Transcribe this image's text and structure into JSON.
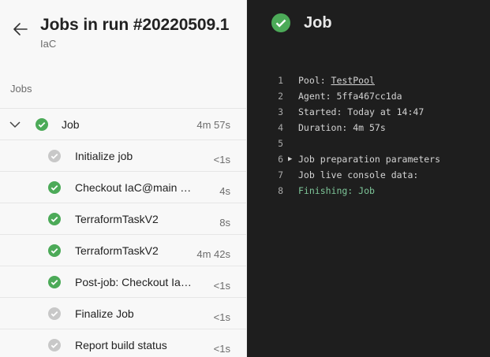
{
  "left": {
    "title": "Jobs in run #20220509.1",
    "subtitle": "IaC",
    "section_label": "Jobs",
    "job": {
      "name": "Job",
      "duration": "4m 57s",
      "status": "succeeded"
    },
    "steps": [
      {
        "name": "Initialize job",
        "duration": "<1s",
        "status": "skipped"
      },
      {
        "name": "Checkout IaC@main to s",
        "duration": "4s",
        "status": "succeeded"
      },
      {
        "name": "TerraformTaskV2",
        "duration": "8s",
        "status": "succeeded"
      },
      {
        "name": "TerraformTaskV2",
        "duration": "4m 42s",
        "status": "succeeded"
      },
      {
        "name": "Post-job: Checkout Ia…",
        "duration": "<1s",
        "status": "succeeded"
      },
      {
        "name": "Finalize Job",
        "duration": "<1s",
        "status": "skipped"
      },
      {
        "name": "Report build status",
        "duration": "<1s",
        "status": "skipped"
      }
    ]
  },
  "right": {
    "title": "Job",
    "console": [
      {
        "num": "1",
        "prefix": "Pool: ",
        "link": "TestPool"
      },
      {
        "num": "2",
        "text": "Agent: 5ffa467cc1da"
      },
      {
        "num": "3",
        "text": "Started: Today at 14:47"
      },
      {
        "num": "4",
        "text": "Duration: 4m 57s"
      },
      {
        "num": "5",
        "text": ""
      },
      {
        "num": "6",
        "arrow": "▶",
        "text": "Job preparation parameters"
      },
      {
        "num": "7",
        "text": "Job live console data:"
      },
      {
        "num": "8",
        "text": "Finishing: Job"
      }
    ]
  },
  "colors": {
    "success": "#4caa58",
    "skipped": "#c8c8c8",
    "console_green": "#7ec699"
  },
  "icons": {
    "back": "arrow-left-icon",
    "expand": "chevron-down-icon",
    "success": "check-circle-icon",
    "skipped": "check-circle-gray-icon",
    "expand_row": "triangle-right-icon"
  }
}
